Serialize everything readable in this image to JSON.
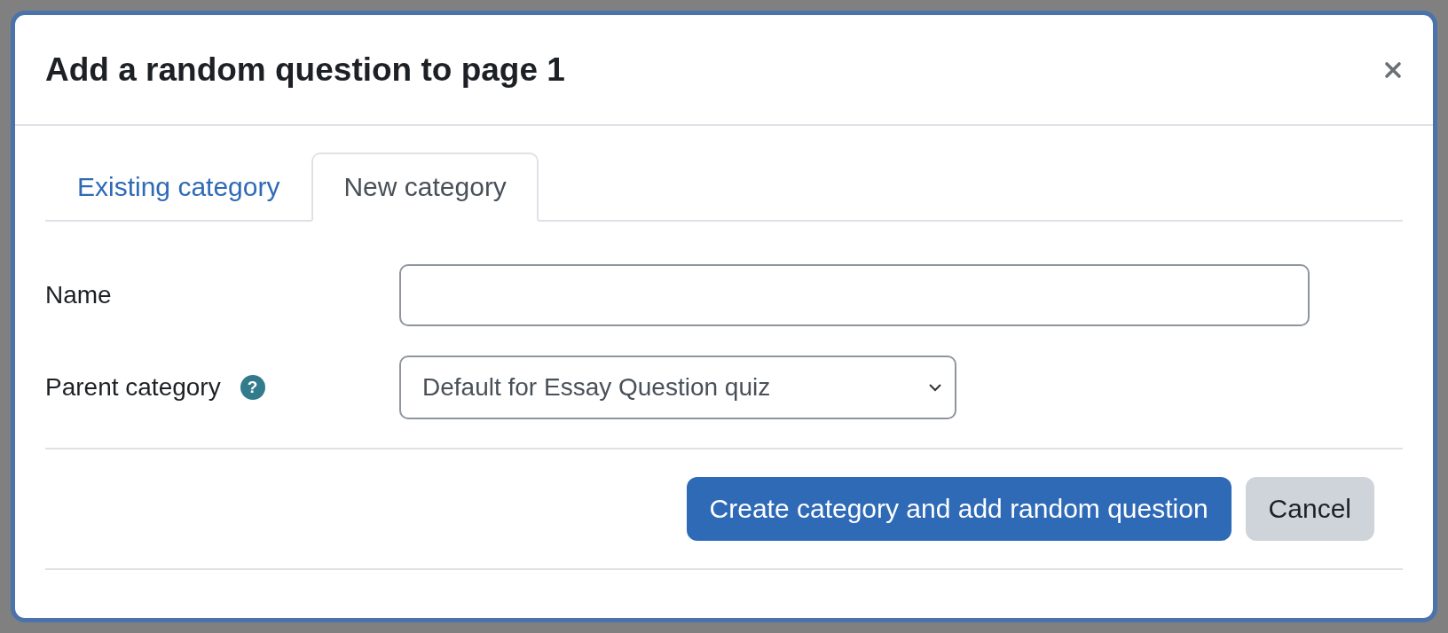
{
  "dialog": {
    "title": "Add a random question to page 1"
  },
  "tabs": [
    {
      "label": "Existing category",
      "selected": false
    },
    {
      "label": "New category",
      "selected": true
    }
  ],
  "form": {
    "name": {
      "label": "Name"
    },
    "parent_category": {
      "label": "Parent category",
      "help": "?",
      "value": "Default for Essay Question quiz"
    }
  },
  "buttons": [
    {
      "label": "Create category and add random question",
      "kind": "primary"
    },
    {
      "label": "Cancel",
      "kind": "secondary"
    }
  ]
}
